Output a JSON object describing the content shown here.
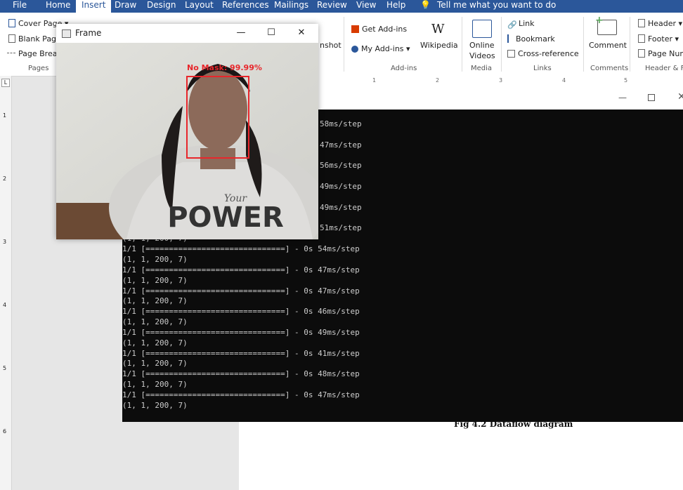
{
  "menu": [
    "File",
    "Home",
    "Insert",
    "Draw",
    "Design",
    "Layout",
    "References",
    "Mailings",
    "Review",
    "View",
    "Help"
  ],
  "tell_me": "Tell me what you want to do",
  "ribbon": {
    "pages": {
      "cover_page": "Cover Page",
      "blank_page": "Blank Page",
      "page_break": "Page Break",
      "group": "Pages"
    },
    "screenshot_label": "nshot",
    "addins": {
      "get": "Get Add-ins",
      "my": "My Add-ins",
      "wikipedia": "Wikipedia",
      "group": "Add-ins"
    },
    "media": {
      "online_videos_1": "Online",
      "online_videos_2": "Videos",
      "group": "Media"
    },
    "links": {
      "link": "Link",
      "bookmark": "Bookmark",
      "cross_ref": "Cross-reference",
      "group": "Links"
    },
    "comments": {
      "comment": "Comment",
      "group": "Comments"
    },
    "header_footer": {
      "header": "Header",
      "footer": "Footer",
      "page_number": "Page Num",
      "group": "Header & Fo"
    }
  },
  "frame_window": {
    "title": "Frame",
    "detection_label": "No Mask: 99.99%",
    "shirt_text": "POWER",
    "shirt_script": "Your",
    "colors": {
      "box": "#e8262b"
    }
  },
  "console": {
    "lines": [
      "58ms/step",
      "",
      "47ms/step",
      "",
      "56ms/step",
      "",
      "49ms/step",
      "",
      "49ms/step",
      "",
      "51ms/step",
      "(1, 1, 200, 7)",
      "1/1 [==============================] - 0s 54ms/step",
      "(1, 1, 200, 7)",
      "1/1 [==============================] - 0s 47ms/step",
      "(1, 1, 200, 7)",
      "1/1 [==============================] - 0s 47ms/step",
      "(1, 1, 200, 7)",
      "1/1 [==============================] - 0s 46ms/step",
      "(1, 1, 200, 7)",
      "1/1 [==============================] - 0s 49ms/step",
      "(1, 1, 200, 7)",
      "1/1 [==============================] - 0s 41ms/step",
      "(1, 1, 200, 7)",
      "1/1 [==============================] - 0s 48ms/step",
      "(1, 1, 200, 7)",
      "1/1 [==============================] - 0s 47ms/step",
      "(1, 1, 200, 7)"
    ]
  },
  "document": {
    "caption": "Fig 4.2 Dataflow diagram"
  },
  "ruler_numbers": [
    "1",
    "2",
    "3",
    "4",
    "5"
  ],
  "left_ruler_numbers": [
    "1",
    "2",
    "3",
    "4",
    "5",
    "6"
  ]
}
